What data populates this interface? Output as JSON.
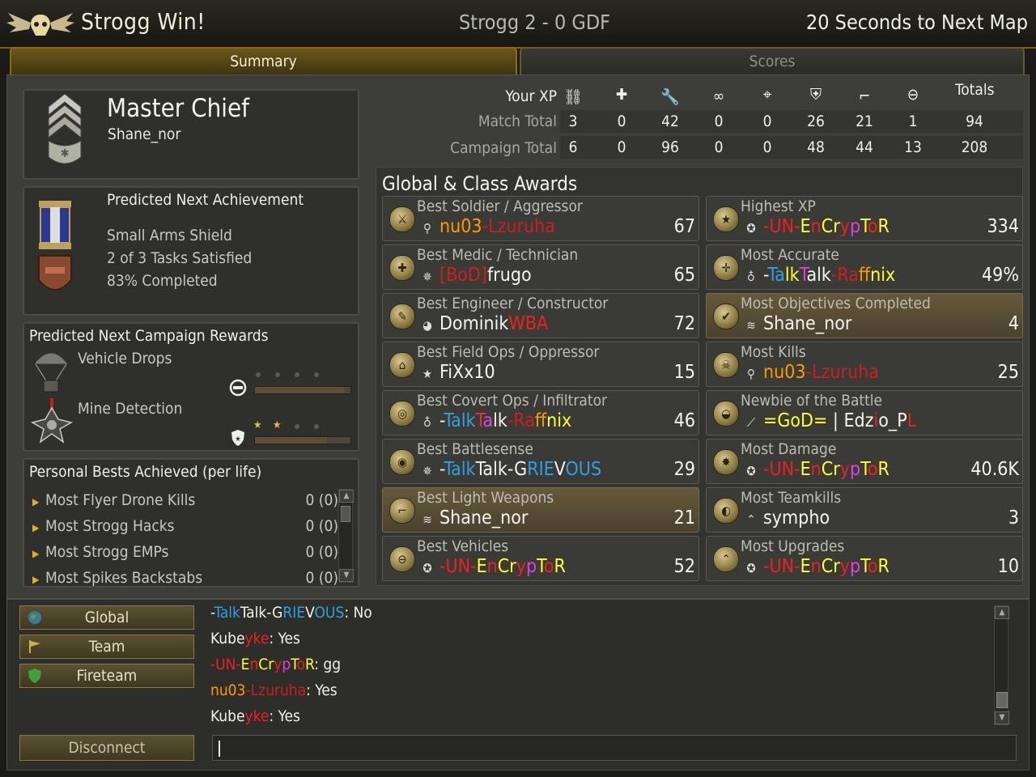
{
  "header": {
    "win_text": "Strogg Win!",
    "score_text": "Strogg 2 - 0 GDF",
    "next_map_text": "20 Seconds to Next Map"
  },
  "tabs": [
    {
      "label": "Summary",
      "active": true
    },
    {
      "label": "Scores",
      "active": false
    }
  ],
  "player": {
    "rank": "Master Chief",
    "name": "Shane_nor",
    "rank_icon": "master-chief-rank-icon"
  },
  "achievement": {
    "heading": "Predicted Next Achievement",
    "name": "Small Arms Shield",
    "tasks": "2 of 3 Tasks Satisfied",
    "progress": "83% Completed",
    "icons": [
      "blue-medal-icon",
      "weapon-shield-badge-icon"
    ]
  },
  "rewards": {
    "heading": "Predicted Next Campaign Rewards",
    "items": [
      {
        "name": "Vehicle Drops",
        "icon": "parachute-drop-icon",
        "class_icon": "vehicles-icon",
        "stars_filled": 0,
        "stars_total": 4,
        "progress": 0.93
      },
      {
        "name": "Mine Detection",
        "icon": "mine-icon",
        "class_icon": "shield-icon",
        "stars_filled": 2,
        "stars_total": 4,
        "progress": 0.75
      }
    ]
  },
  "personal_bests": {
    "heading": "Personal Bests Achieved (per life)",
    "rows": [
      {
        "label": "Most Flyer Drone Kills",
        "value": "0 (0)"
      },
      {
        "label": "Most Strogg Hacks",
        "value": "0 (0)"
      },
      {
        "label": "Most Strogg EMPs",
        "value": "0 (0)"
      },
      {
        "label": "Most Spikes Backstabs",
        "value": "0 (0)"
      }
    ]
  },
  "xp_table": {
    "your_xp_label": "Your XP",
    "totals_label": "Totals",
    "icons": [
      "soldier-icon",
      "medic-cross-icon",
      "wrench-icon",
      "binoculars-icon",
      "crosshair-icon",
      "shield-icon",
      "gun-icon",
      "vehicles-icon"
    ],
    "rows": [
      {
        "label": "Match Total",
        "values": [
          "3",
          "0",
          "42",
          "0",
          "0",
          "26",
          "21",
          "1"
        ],
        "total": "94"
      },
      {
        "label": "Campaign Total",
        "values": [
          "6",
          "0",
          "96",
          "0",
          "0",
          "48",
          "44",
          "13"
        ],
        "total": "208"
      }
    ]
  },
  "awards": {
    "heading": "Global & Class Awards",
    "left": [
      {
        "title": "Best Soldier / Aggressor",
        "player": [
          {
            "t": "nu03",
            "c": "#ff9900"
          },
          {
            "t": "-Lzuruha",
            "c": "#cc2020"
          }
        ],
        "value": "67",
        "icon": "soldier-emblem-icon",
        "rank_icon": "private-rank-icon",
        "highlight": false
      },
      {
        "title": "Best Medic / Technician",
        "player": [
          {
            "t": "[BoD]",
            "c": "#cc2020"
          },
          {
            "t": "frugo",
            "c": "#f4f4ee"
          }
        ],
        "value": "65",
        "icon": "medic-emblem-icon",
        "rank_icon": "general-star-icon",
        "highlight": false
      },
      {
        "title": "Best Engineer / Constructor",
        "player": [
          {
            "t": "Dominik",
            "c": "#f4f4ee"
          },
          {
            "t": "WBA",
            "c": "#ee2020"
          }
        ],
        "value": "72",
        "icon": "engineer-emblem-icon",
        "rank_icon": "eagle-rank-icon",
        "highlight": false
      },
      {
        "title": "Best Field Ops / Oppressor",
        "player": [
          {
            "t": "FiXx10",
            "c": "#f4f4ee"
          }
        ],
        "value": "15",
        "icon": "fieldops-emblem-icon",
        "rank_icon": "star-rank-icon",
        "highlight": false
      },
      {
        "title": "Best Covert Ops / Infiltrator",
        "player": [
          {
            "t": "-",
            "c": "#f4f4ee"
          },
          {
            "t": "Talk",
            "c": "#30a0e0"
          },
          {
            "t": "T",
            "c": "#ee3030"
          },
          {
            "t": "a",
            "c": "#e040e0"
          },
          {
            "t": "lk",
            "c": "#f4f4ee"
          },
          {
            "t": "-Ra",
            "c": "#cc2020"
          },
          {
            "t": "ff",
            "c": "#ff9900"
          },
          {
            "t": "nix",
            "c": "#ffff30"
          }
        ],
        "value": "46",
        "icon": "covertops-emblem-icon",
        "rank_icon": "medal-rank-icon",
        "highlight": false
      },
      {
        "title": "Best Battlesense",
        "player": [
          {
            "t": "-",
            "c": "#f4f4ee"
          },
          {
            "t": "Talk",
            "c": "#30a0e0"
          },
          {
            "t": "Talk",
            "c": "#f4f4ee"
          },
          {
            "t": "-G",
            "c": "#f4f4ee"
          },
          {
            "t": "RIE",
            "c": "#30a0e0"
          },
          {
            "t": "V",
            "c": "#f4f4ee"
          },
          {
            "t": "OUS",
            "c": "#30a0e0"
          }
        ],
        "value": "29",
        "icon": "battlesense-emblem-icon",
        "rank_icon": "general-star-icon",
        "highlight": false
      },
      {
        "title": "Best Light Weapons",
        "player": [
          {
            "t": "Shane_nor",
            "c": "#f4f4ee"
          }
        ],
        "value": "21",
        "icon": "light-weapons-emblem-icon",
        "rank_icon": "master-chief-rank-icon",
        "highlight": true
      },
      {
        "title": "Best Vehicles",
        "player": [
          {
            "t": "-UN-",
            "c": "#ee2020"
          },
          {
            "t": "E",
            "c": "#ffff30"
          },
          {
            "t": "n",
            "c": "#ee2020"
          },
          {
            "t": "Cr",
            "c": "#ffff30"
          },
          {
            "t": "y",
            "c": "#ee2020"
          },
          {
            "t": "p",
            "c": "#e040e0"
          },
          {
            "t": "T",
            "c": "#ffff30"
          },
          {
            "t": "o",
            "c": "#ee2020"
          },
          {
            "t": "R",
            "c": "#ffff30"
          }
        ],
        "value": "52",
        "icon": "vehicles-emblem-icon",
        "rank_icon": "star-circle-rank-icon",
        "highlight": false
      }
    ],
    "right": [
      {
        "title": "Highest XP",
        "player": [
          {
            "t": "-UN-",
            "c": "#ee2020"
          },
          {
            "t": "E",
            "c": "#ffff30"
          },
          {
            "t": "n",
            "c": "#ee2020"
          },
          {
            "t": "Cr",
            "c": "#ffff30"
          },
          {
            "t": "y",
            "c": "#ee2020"
          },
          {
            "t": "p",
            "c": "#e040e0"
          },
          {
            "t": "T",
            "c": "#ffff30"
          },
          {
            "t": "o",
            "c": "#ee2020"
          },
          {
            "t": "R",
            "c": "#ffff30"
          }
        ],
        "value": "334",
        "icon": "star-emblem-icon",
        "rank_icon": "star-circle-rank-icon",
        "highlight": false
      },
      {
        "title": "Most Accurate",
        "player": [
          {
            "t": "-",
            "c": "#f4f4ee"
          },
          {
            "t": "Ta",
            "c": "#30a0e0"
          },
          {
            "t": "lk",
            "c": "#ffff30"
          },
          {
            "t": "T",
            "c": "#e040e0"
          },
          {
            "t": "alk",
            "c": "#f4f4ee"
          },
          {
            "t": "-Ra",
            "c": "#cc2020"
          },
          {
            "t": "ff",
            "c": "#ff9900"
          },
          {
            "t": "nix",
            "c": "#ffff30"
          }
        ],
        "value": "49%",
        "icon": "accuracy-emblem-icon",
        "rank_icon": "medal-rank-icon",
        "highlight": false
      },
      {
        "title": "Most Objectives Completed",
        "player": [
          {
            "t": "Shane_nor",
            "c": "#f4f4ee"
          }
        ],
        "value": "4",
        "icon": "objective-check-emblem-icon",
        "rank_icon": "master-chief-rank-icon",
        "highlight": true
      },
      {
        "title": "Most Kills",
        "player": [
          {
            "t": "nu03",
            "c": "#ff9900"
          },
          {
            "t": "-Lzuruha",
            "c": "#cc2020"
          }
        ],
        "value": "25",
        "icon": "kills-emblem-icon",
        "rank_icon": "private-rank-icon",
        "highlight": false
      },
      {
        "title": "Newbie of the Battle",
        "player": [
          {
            "t": "=GoD=",
            "c": "#ffff30"
          },
          {
            "t": " | ",
            "c": "#f4f4ee"
          },
          {
            "t": "E",
            "c": "#f4f4ee"
          },
          {
            "t": "dz",
            "c": "#f4f4ee"
          },
          {
            "t": "i",
            "c": "#ee2020"
          },
          {
            "t": "o_P",
            "c": "#f4f4ee"
          },
          {
            "t": "L",
            "c": "#ee2020"
          }
        ],
        "value": "",
        "icon": "newbie-emblem-icon",
        "rank_icon": "feather-rank-icon",
        "highlight": false
      },
      {
        "title": "Most Damage",
        "player": [
          {
            "t": "-UN-",
            "c": "#ee2020"
          },
          {
            "t": "E",
            "c": "#ffff30"
          },
          {
            "t": "n",
            "c": "#ee2020"
          },
          {
            "t": "Cr",
            "c": "#ffff30"
          },
          {
            "t": "y",
            "c": "#ee2020"
          },
          {
            "t": "p",
            "c": "#e040e0"
          },
          {
            "t": "T",
            "c": "#ffff30"
          },
          {
            "t": "o",
            "c": "#ee2020"
          },
          {
            "t": "R",
            "c": "#ffff30"
          }
        ],
        "value": "40.6K",
        "icon": "damage-emblem-icon",
        "rank_icon": "star-circle-rank-icon",
        "highlight": false
      },
      {
        "title": "Most Teamkills",
        "player": [
          {
            "t": "sympho",
            "c": "#f4f4ee"
          }
        ],
        "value": "3",
        "icon": "teamkill-emblem-icon",
        "rank_icon": "chevron-rank-icon",
        "highlight": false
      },
      {
        "title": "Most Upgrades",
        "player": [
          {
            "t": "-UN-",
            "c": "#ee2020"
          },
          {
            "t": "E",
            "c": "#ffff30"
          },
          {
            "t": "n",
            "c": "#ee2020"
          },
          {
            "t": "Cr",
            "c": "#ffff30"
          },
          {
            "t": "y",
            "c": "#ee2020"
          },
          {
            "t": "p",
            "c": "#e040e0"
          },
          {
            "t": "T",
            "c": "#ffff30"
          },
          {
            "t": "o",
            "c": "#ee2020"
          },
          {
            "t": "R",
            "c": "#ffff30"
          }
        ],
        "value": "10",
        "icon": "upgrade-emblem-icon",
        "rank_icon": "star-circle-rank-icon",
        "highlight": false
      }
    ]
  },
  "chat": {
    "channels": [
      {
        "label": "Global",
        "icon": "globe-icon"
      },
      {
        "label": "Team",
        "icon": "flag-icon"
      },
      {
        "label": "Fireteam",
        "icon": "shield-icon"
      }
    ],
    "disconnect_label": "Disconnect",
    "input_value": "",
    "messages": [
      {
        "name": [
          {
            "t": "-",
            "c": "#f4f4ee"
          },
          {
            "t": "Talk",
            "c": "#30a0e0"
          },
          {
            "t": "Talk",
            "c": "#f4f4ee"
          },
          {
            "t": "-G",
            "c": "#f4f4ee"
          },
          {
            "t": "RIE",
            "c": "#30a0e0"
          },
          {
            "t": "V",
            "c": "#f4f4ee"
          },
          {
            "t": "OUS",
            "c": "#30a0e0"
          }
        ],
        "text": ": No"
      },
      {
        "name": [
          {
            "t": "Kube",
            "c": "#f4f4ee"
          },
          {
            "t": "yke",
            "c": "#ee2020"
          }
        ],
        "text": ": Yes"
      },
      {
        "name": [
          {
            "t": "-UN-",
            "c": "#ee2020"
          },
          {
            "t": "E",
            "c": "#ffff30"
          },
          {
            "t": "n",
            "c": "#ee2020"
          },
          {
            "t": "Cr",
            "c": "#ffff30"
          },
          {
            "t": "y",
            "c": "#ee2020"
          },
          {
            "t": "p",
            "c": "#e040e0"
          },
          {
            "t": "T",
            "c": "#ffff30"
          },
          {
            "t": "o",
            "c": "#ee2020"
          },
          {
            "t": "R",
            "c": "#ffff30"
          }
        ],
        "text": ": gg"
      },
      {
        "name": [
          {
            "t": "nu03",
            "c": "#ff9900"
          },
          {
            "t": "-Lzuruha",
            "c": "#cc2020"
          }
        ],
        "text": ": Yes"
      },
      {
        "name": [
          {
            "t": "Kube",
            "c": "#f4f4ee"
          },
          {
            "t": "yke",
            "c": "#ee2020"
          }
        ],
        "text": ": Yes"
      }
    ]
  }
}
